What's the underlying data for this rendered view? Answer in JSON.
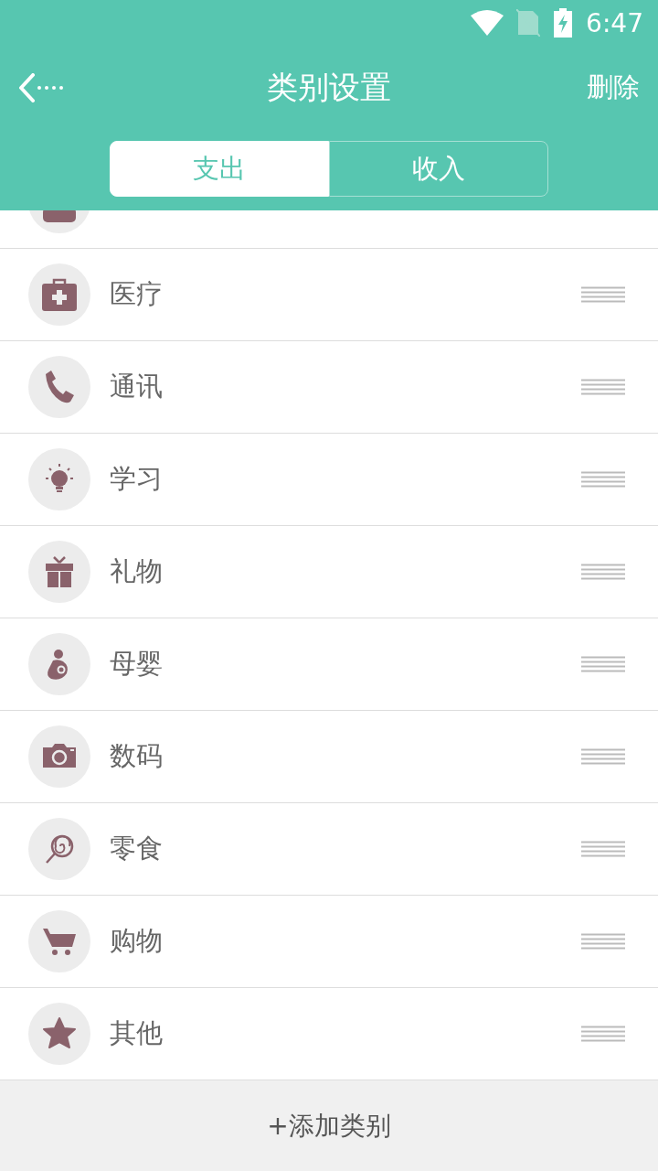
{
  "status_bar": {
    "time": "6:47"
  },
  "header": {
    "title": "类别设置",
    "action": "删除"
  },
  "tabs": [
    {
      "label": "支出",
      "selected": true
    },
    {
      "label": "收入",
      "selected": false
    }
  ],
  "categories": [
    {
      "label": "医疗",
      "kind": "medical"
    },
    {
      "label": "通讯",
      "kind": "phone"
    },
    {
      "label": "学习",
      "kind": "bulb"
    },
    {
      "label": "礼物",
      "kind": "gift"
    },
    {
      "label": "母婴",
      "kind": "baby"
    },
    {
      "label": "数码",
      "kind": "camera"
    },
    {
      "label": "零食",
      "kind": "lollipop"
    },
    {
      "label": "购物",
      "kind": "cart"
    },
    {
      "label": "其他",
      "kind": "star"
    }
  ],
  "add_button": "+添加类别"
}
